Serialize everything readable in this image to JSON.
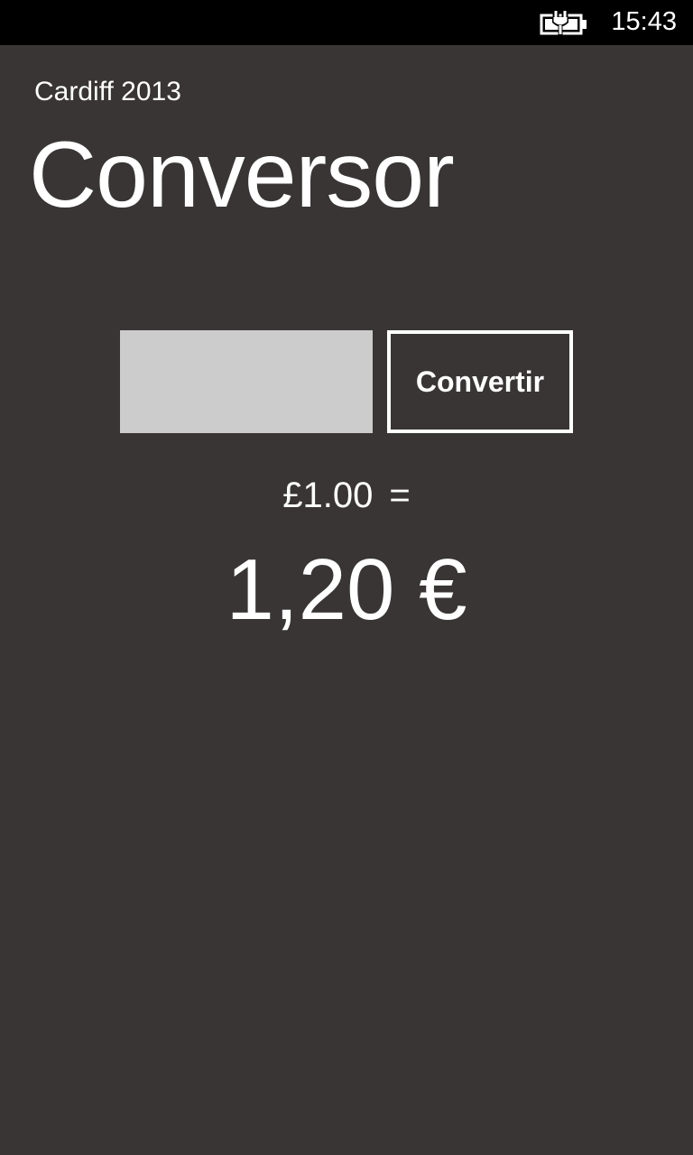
{
  "status_bar": {
    "battery_icon": "battery-charging-icon",
    "time": "15:43"
  },
  "header": {
    "app_title": "Cardiff 2013",
    "page_title": "Conversor"
  },
  "converter": {
    "input_value": "",
    "button_label": "Convertir",
    "source_amount": "£1.00",
    "equals": "=",
    "result": "1,20 €"
  },
  "colors": {
    "background": "#393535",
    "status_bar": "#000000",
    "input_background": "#cccccc",
    "text": "#ffffff"
  }
}
